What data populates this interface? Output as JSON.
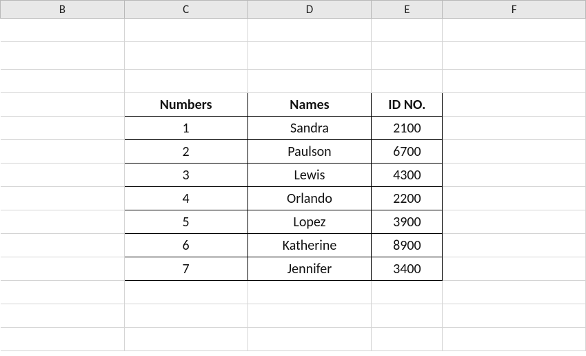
{
  "columns": {
    "B": "B",
    "C": "C",
    "D": "D",
    "E": "E",
    "F": "F"
  },
  "headers": {
    "numbers": "Numbers",
    "names": "Names",
    "id_no": "ID NO."
  },
  "rows": [
    {
      "num": "1",
      "name": "Sandra",
      "id": "2100"
    },
    {
      "num": "2",
      "name": "Paulson",
      "id": "6700"
    },
    {
      "num": "3",
      "name": "Lewis",
      "id": "4300"
    },
    {
      "num": "4",
      "name": "Orlando",
      "id": "2200"
    },
    {
      "num": "5",
      "name": "Lopez",
      "id": "3900"
    },
    {
      "num": "6",
      "name": "Katherine",
      "id": "8900"
    },
    {
      "num": "7",
      "name": "Jennifer",
      "id": "3400"
    }
  ]
}
